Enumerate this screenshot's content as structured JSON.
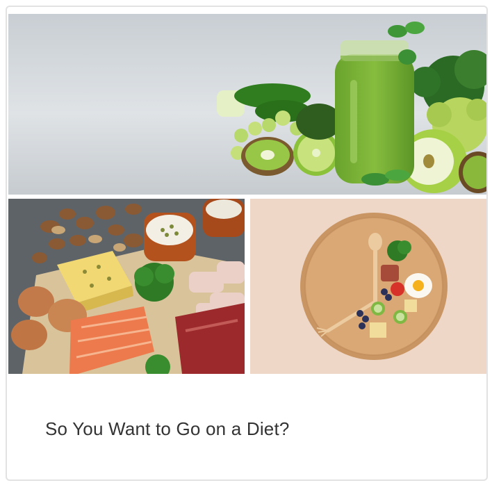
{
  "card": {
    "title": "So You Want to Go on a Diet?",
    "images": [
      {
        "icon": "green-smoothie-and-vegetables-image"
      },
      {
        "icon": "keto-foods-image"
      },
      {
        "icon": "plate-clock-image"
      }
    ]
  },
  "colors": {
    "border": "#e2e2e2",
    "title_text": "#333333"
  }
}
